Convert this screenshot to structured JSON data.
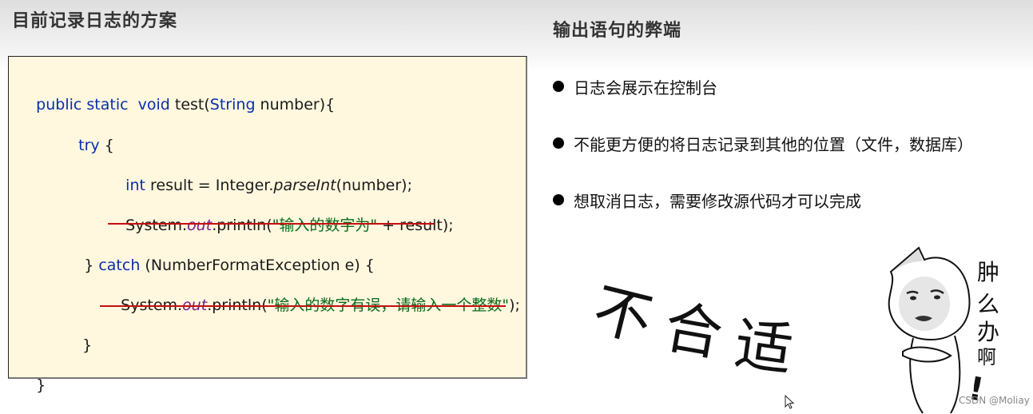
{
  "left_panel": {
    "title": "目前记录日志的方案",
    "code": {
      "line1": {
        "kw1": "public static  void",
        "plain1": " test(",
        "kw2": "String",
        "plain2": " number){"
      },
      "line2": {
        "kw": "try",
        "plain": " {"
      },
      "line3": {
        "kw": "int",
        "plain1": " result = Integer.",
        "italic": "parseInt",
        "plain2": "(number);"
      },
      "line4": {
        "plain1": "System.",
        "italic": "out",
        "plain2": ".println(",
        "str": "\"输入的数字为\"",
        "plain3": " + result);"
      },
      "line5": {
        "plain1": " } ",
        "kw": "catch",
        "plain2": " (NumberFormatException e) {"
      },
      "line6": {
        "plain1": "System.",
        "italic": "out",
        "plain2": ".println(",
        "str": "\"输入的数字有误，请输入一个整数\"",
        "plain3": ");"
      },
      "line7": {
        "plain": "}"
      },
      "line8": {
        "plain": "}"
      }
    },
    "colors": {
      "code_bg": "#fff8df",
      "keyword": "#0a2ea8",
      "string": "#0a6a1a",
      "static_field": "#7a1e8e",
      "underline": "#c41010"
    }
  },
  "right_panel": {
    "title": "输出语句的弊端",
    "bullets": [
      "日志会展示在控制台",
      "不能更方便的将日志记录到其他的位置（文件，数据库）",
      "想取消日志，需要修改源代码才可以完成"
    ],
    "meme_caption": [
      "不",
      "合",
      "适"
    ],
    "meme_figure_text": [
      "肿",
      "么",
      "办",
      "啊",
      "!"
    ]
  },
  "watermark": "CSDN @Moliay"
}
